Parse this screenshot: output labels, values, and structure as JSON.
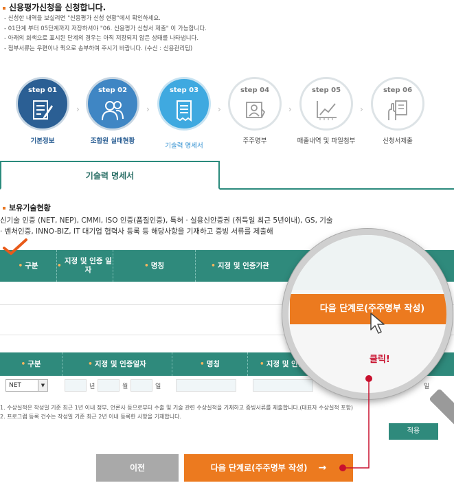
{
  "header": {
    "title": "신용평가신청을 신청합니다.",
    "notes": [
      "- 신청한 내역을 보실려면 \"신용평가 신청 현황\"에서 확인하세요.",
      "- 01단계 부터 05단계까지 저장하셔야 \"06. 신용평가 신청서 제출\" 이 가능합니다.",
      "- 아래의 회색으로 표시된 단계의 경우는 아직 저장되지 않은 상태를 나타냅니다.",
      "- 첨부서류는 우편이나 퀵으로 송부하여 주시기 바랍니다. (수신 : 신용관리팀)"
    ]
  },
  "steps": [
    {
      "num": "step 01",
      "label": "기본정보",
      "state": "done",
      "icon": "form-edit-icon"
    },
    {
      "num": "step 02",
      "label": "조합원 실태현황",
      "state": "done",
      "icon": "people-icon"
    },
    {
      "num": "step 03",
      "label": "기술력 명세서",
      "state": "current",
      "icon": "receipt-icon"
    },
    {
      "num": "step 04",
      "label": "주주명부",
      "state": "todo",
      "icon": "id-card-icon"
    },
    {
      "num": "step 05",
      "label": "매출내역 및 파일첨부",
      "state": "todo",
      "icon": "chart-icon"
    },
    {
      "num": "step 06",
      "label": "신청서제출",
      "state": "todo",
      "icon": "hand-document-icon"
    }
  ],
  "tab": {
    "label": "기술력 명세서"
  },
  "section": {
    "title": "보유기술현황",
    "desc": "신기술 인증 (NET, NEP), CMMI, ISO 인증(품질인증), 특허 · 실용신안증권 (취득일 최근 5년이내), GS, 기술 · 벤처인증, INNO-BIZ, IT 대기업 협력사 등록 등 해당사항을 기재하고 증빙 서류를 제출해"
  },
  "table1": {
    "headers": [
      "구분",
      "지정 및 인증 일자",
      "명칭",
      "지정 및 인증기관"
    ]
  },
  "table2": {
    "headers": [
      "구분",
      "지정 및 인증일자",
      "명칭",
      "지정 및 인증기"
    ]
  },
  "form": {
    "type_value": "NET",
    "year_unit": "년",
    "month_unit": "월",
    "day_unit": "일",
    "day_unit_right": "일"
  },
  "footnotes": [
    "1. 수상실적은 작성일 기준 최근 1년 이내 정부, 언론사 등으로부터 수출 및 기술 관련 수상실적을 기재하고 증빙서류를 제출합니다.(대표자 수상실적 포함)",
    "2. 프로그램 등록 건수는 작성일 기준 최근 2년 이내 등록한 사항을 기재합니다."
  ],
  "buttons": {
    "apply": "적용",
    "prev": "이전",
    "next": "다음 단계로(주주명부 작성)",
    "next_arrow": "→"
  },
  "magnifier": {
    "button": "다음 단계로(주주명부 작성)",
    "click": "클릭!"
  },
  "colors": {
    "accent_teal": "#2f8a7c",
    "accent_orange": "#ec7a1f",
    "step_dark": "#2b5f94",
    "step_current": "#3fa9e0",
    "highlight_red": "#c8102e"
  }
}
